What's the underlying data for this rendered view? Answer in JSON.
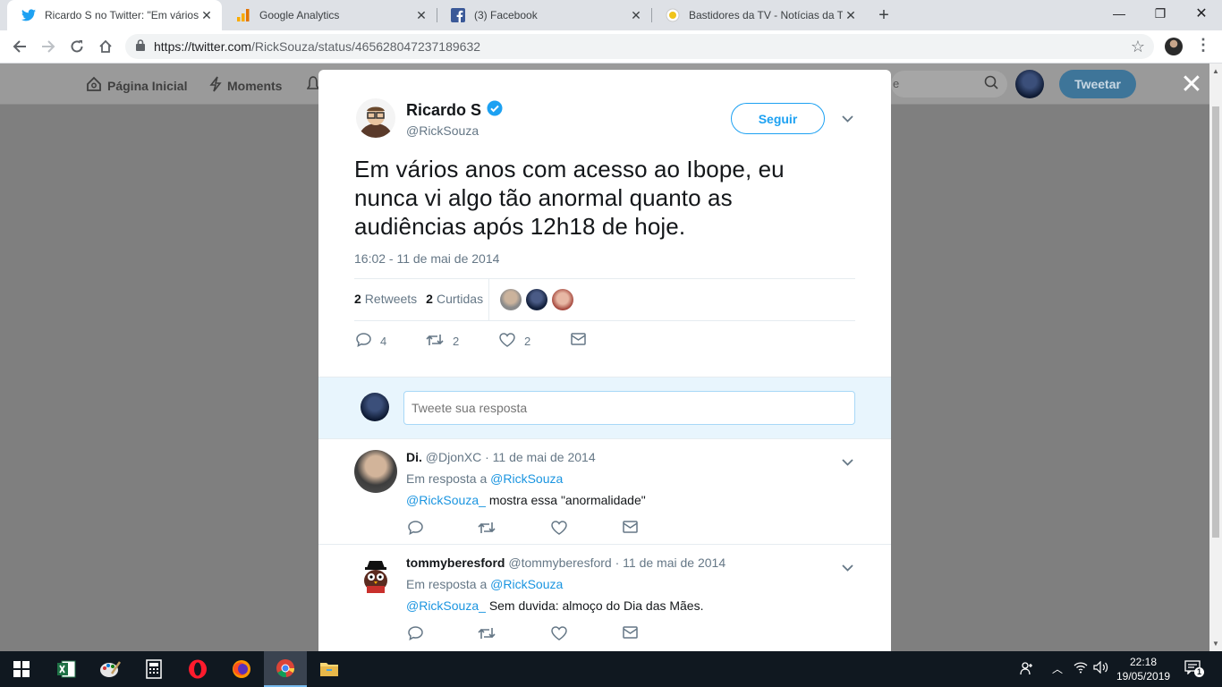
{
  "browser": {
    "tabs": [
      {
        "title": "Ricardo S no Twitter: \"Em vários a",
        "icon": "twitter-icon",
        "active": true
      },
      {
        "title": "Google Analytics",
        "icon": "analytics-icon",
        "active": false
      },
      {
        "title": "(3) Facebook",
        "icon": "facebook-icon",
        "active": false
      },
      {
        "title": "Bastidores da TV - Notícias da TV",
        "icon": "bastidores-icon",
        "active": false
      }
    ],
    "new_tab": "+",
    "url_host": "https://twitter.com",
    "url_path": "/RickSouza/status/465628047237189632"
  },
  "twitter_bar": {
    "home": "Página Inicial",
    "moments": "Moments",
    "search_partial": "e",
    "tweet_button": "Tweetar"
  },
  "tweet": {
    "author_name": "Ricardo S",
    "author_handle": "@RickSouza",
    "follow_label": "Seguir",
    "text": "Em vários anos com acesso ao Ibope, eu nunca vi algo tão anormal quanto as audiências após 12h18 de hoje.",
    "timestamp": "16:02 - 11 de mai de 2014",
    "retweets_count": "2",
    "retweets_label": "Retweets",
    "likes_count": "2",
    "likes_label": "Curtidas",
    "reply_count": "4",
    "retweet_count_action": "2",
    "like_count_action": "2"
  },
  "reply_box": {
    "placeholder": "Tweete sua resposta"
  },
  "replies": [
    {
      "name": "Di.",
      "handle": "@DjonXC",
      "date": "· 11 de mai de 2014",
      "in_reply_prefix": "Em resposta a",
      "in_reply_to": "@RickSouza",
      "mention": "@RickSouza_",
      "text": "mostra essa \"anormalidade\""
    },
    {
      "name": "tommyberesford",
      "handle": "@tommyberesford",
      "date": "· 11 de mai de 2014",
      "in_reply_prefix": "Em resposta a",
      "in_reply_to": "@RickSouza",
      "mention": "@RickSouza_",
      "text": "Sem duvida: almoço do Dia das Mães."
    }
  ],
  "taskbar": {
    "time": "22:18",
    "date": "19/05/2019",
    "notifications": "1"
  },
  "colors": {
    "twitter_blue": "#1da1f2",
    "link_blue": "#1b95e0",
    "overlay": "#7f7f7f",
    "taskbar": "#101820"
  }
}
